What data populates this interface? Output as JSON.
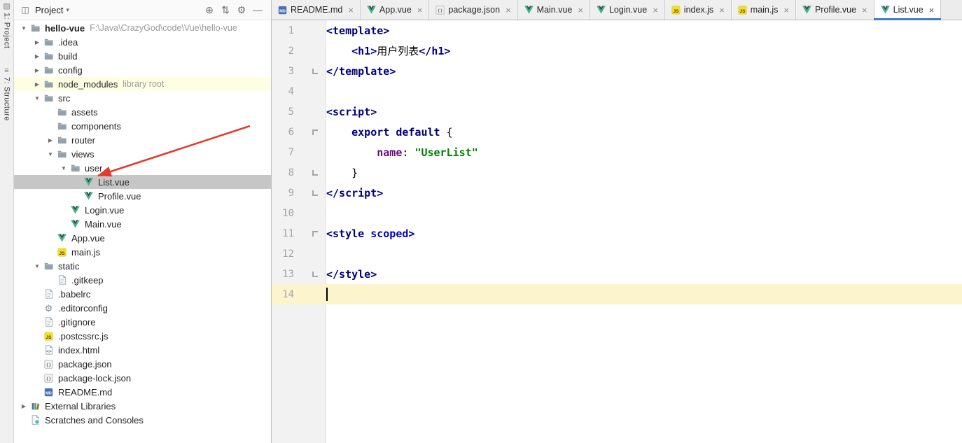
{
  "stripe": {
    "project_button": "1: Project",
    "structure_button": "7: Structure"
  },
  "project_panel": {
    "title": "Project",
    "header_icons": [
      "locate",
      "collapse-all",
      "settings",
      "hide"
    ],
    "tree": [
      {
        "label": "hello-vue",
        "suffix": "F:\\Java\\CrazyGod\\code\\Vue\\hello-vue",
        "depth": 0,
        "icon": "folder",
        "arrow": "open",
        "bold": true
      },
      {
        "label": ".idea",
        "depth": 1,
        "icon": "folder",
        "arrow": "closed"
      },
      {
        "label": "build",
        "depth": 1,
        "icon": "folder",
        "arrow": "closed"
      },
      {
        "label": "config",
        "depth": 1,
        "icon": "folder",
        "arrow": "closed"
      },
      {
        "label": "node_modules",
        "suffix": "library root",
        "depth": 1,
        "icon": "folder",
        "arrow": "closed",
        "highlight": true
      },
      {
        "label": "src",
        "depth": 1,
        "icon": "folder",
        "arrow": "open"
      },
      {
        "label": "assets",
        "depth": 2,
        "icon": "folder"
      },
      {
        "label": "components",
        "depth": 2,
        "icon": "folder"
      },
      {
        "label": "router",
        "depth": 2,
        "icon": "folder",
        "arrow": "closed"
      },
      {
        "label": "views",
        "depth": 2,
        "icon": "folder",
        "arrow": "open"
      },
      {
        "label": "user",
        "depth": 3,
        "icon": "folder",
        "arrow": "open"
      },
      {
        "label": "List.vue",
        "depth": 4,
        "icon": "vue",
        "selected": true
      },
      {
        "label": "Profile.vue",
        "depth": 4,
        "icon": "vue"
      },
      {
        "label": "Login.vue",
        "depth": 3,
        "icon": "vue"
      },
      {
        "label": "Main.vue",
        "depth": 3,
        "icon": "vue"
      },
      {
        "label": "App.vue",
        "depth": 2,
        "icon": "vue"
      },
      {
        "label": "main.js",
        "depth": 2,
        "icon": "js"
      },
      {
        "label": "static",
        "depth": 1,
        "icon": "folder",
        "arrow": "open"
      },
      {
        "label": ".gitkeep",
        "depth": 2,
        "icon": "file"
      },
      {
        "label": ".babelrc",
        "depth": 1,
        "icon": "file"
      },
      {
        "label": ".editorconfig",
        "depth": 1,
        "icon": "gear"
      },
      {
        "label": ".gitignore",
        "depth": 1,
        "icon": "file"
      },
      {
        "label": ".postcssrc.js",
        "depth": 1,
        "icon": "js"
      },
      {
        "label": "index.html",
        "depth": 1,
        "icon": "html"
      },
      {
        "label": "package.json",
        "depth": 1,
        "icon": "json"
      },
      {
        "label": "package-lock.json",
        "depth": 1,
        "icon": "json"
      },
      {
        "label": "README.md",
        "depth": 1,
        "icon": "md"
      },
      {
        "label": "External Libraries",
        "depth": 0,
        "icon": "lib",
        "arrow": "closed"
      },
      {
        "label": "Scratches and Consoles",
        "depth": 0,
        "icon": "scratch"
      }
    ]
  },
  "editor": {
    "tabs": [
      {
        "label": "README.md",
        "icon": "md"
      },
      {
        "label": "App.vue",
        "icon": "vue"
      },
      {
        "label": "package.json",
        "icon": "json"
      },
      {
        "label": "Main.vue",
        "icon": "vue"
      },
      {
        "label": "Login.vue",
        "icon": "vue"
      },
      {
        "label": "index.js",
        "icon": "js"
      },
      {
        "label": "main.js",
        "icon": "js"
      },
      {
        "label": "Profile.vue",
        "icon": "vue"
      },
      {
        "label": "List.vue",
        "icon": "vue",
        "active": true
      }
    ],
    "lines": [
      {
        "tokens": [
          [
            "<template>",
            "tag"
          ]
        ]
      },
      {
        "tokens": [
          [
            "    ",
            "pl"
          ],
          [
            "<h1>",
            "tag"
          ],
          [
            "用户列表",
            "pl"
          ],
          [
            "</h1>",
            "tag"
          ]
        ]
      },
      {
        "tokens": [
          [
            "</template>",
            "tag"
          ]
        ],
        "fold": "end"
      },
      {
        "tokens": []
      },
      {
        "tokens": [
          [
            "<script>",
            "tag"
          ]
        ]
      },
      {
        "tokens": [
          [
            "    ",
            "pl"
          ],
          [
            "export",
            "kw"
          ],
          [
            " ",
            "pl"
          ],
          [
            "default",
            "kw"
          ],
          [
            " {",
            "pl"
          ]
        ],
        "fold": "start"
      },
      {
        "tokens": [
          [
            "        ",
            "pl"
          ],
          [
            "name",
            "field"
          ],
          [
            ": ",
            "pl"
          ],
          [
            "\"UserList\"",
            "str"
          ]
        ]
      },
      {
        "tokens": [
          [
            "    }",
            "pl"
          ]
        ],
        "fold": "end"
      },
      {
        "tokens": [
          [
            "</script>",
            "tag"
          ]
        ],
        "fold": "end"
      },
      {
        "tokens": []
      },
      {
        "tokens": [
          [
            "<style ",
            "tag"
          ],
          [
            "scoped",
            "attr"
          ],
          [
            ">",
            "tag"
          ]
        ],
        "fold": "start"
      },
      {
        "tokens": []
      },
      {
        "tokens": [
          [
            "</style>",
            "tag"
          ]
        ],
        "fold": "end"
      },
      {
        "tokens": [],
        "current": true,
        "caret": true
      }
    ]
  },
  "colors": {
    "tab_accent": "#3D7CC2",
    "selection": "#C6C6C6",
    "library_row": "#FFFFE4",
    "current_line": "#FCF4CD",
    "annotation": "#E23B2E",
    "tag_blue": "#000080",
    "string_green": "#008000",
    "field_purple": "#660E7A"
  }
}
